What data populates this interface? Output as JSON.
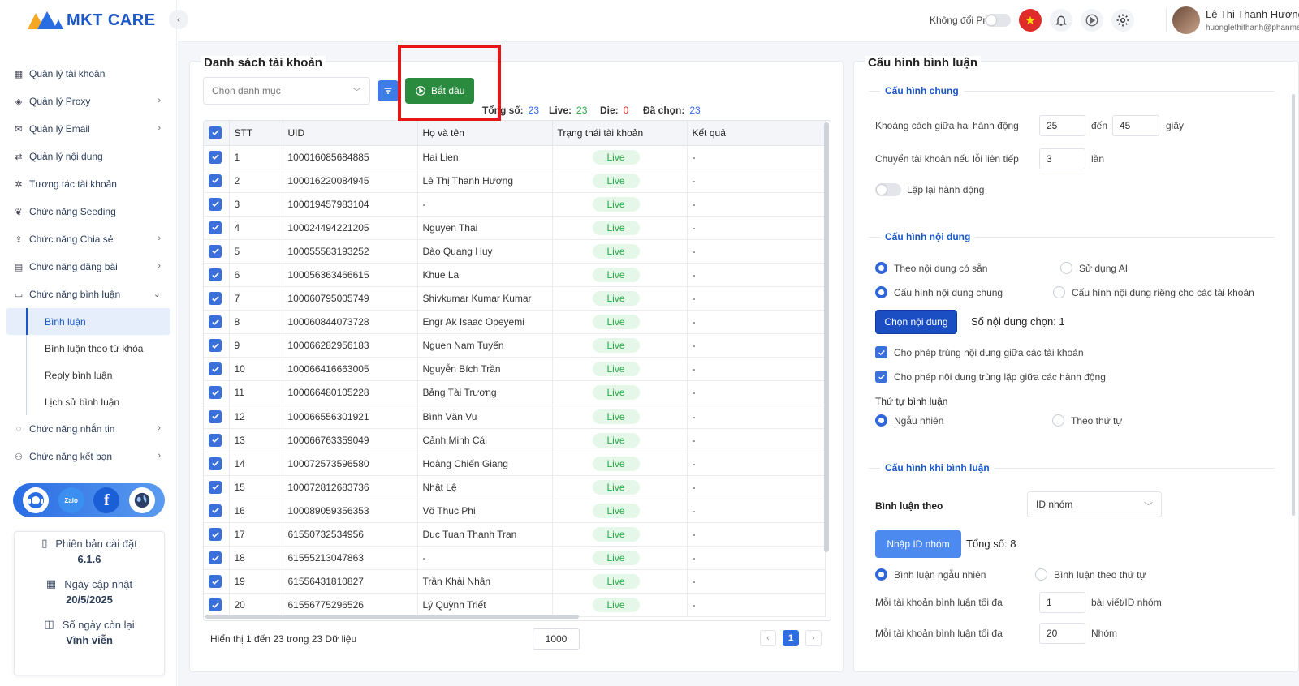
{
  "app": {
    "logo_text": "MKT CARE"
  },
  "sidebar": {
    "collapse_glyph": "‹",
    "items": [
      {
        "label": "Quản lý tài khoản",
        "icon": "grid-icon",
        "has_chevron": false
      },
      {
        "label": "Quản lý Proxy",
        "icon": "layers-icon",
        "has_chevron": true
      },
      {
        "label": "Quản lý Email",
        "icon": "mail-icon",
        "has_chevron": true
      },
      {
        "label": "Quản lý nội dung",
        "icon": "transfer-icon",
        "has_chevron": false
      },
      {
        "label": "Tương tác tài khoản",
        "icon": "sparkle-icon",
        "has_chevron": false
      },
      {
        "label": "Chức năng Seeding",
        "icon": "sprout-icon",
        "has_chevron": false
      },
      {
        "label": "Chức năng Chia sẻ",
        "icon": "share-icon",
        "has_chevron": true
      },
      {
        "label": "Chức năng đăng bài",
        "icon": "post-icon",
        "has_chevron": true
      },
      {
        "label": "Chức năng bình luận",
        "icon": "comment-icon",
        "has_chevron": true
      }
    ],
    "sub_items": [
      "Bình luận",
      "Bình luận theo từ khóa",
      "Reply bình luận",
      "Lịch sử bình luận"
    ],
    "items_after": [
      {
        "label": "Chức năng nhắn tin",
        "icon": "chat-icon"
      },
      {
        "label": "Chức năng kết bạn",
        "icon": "add-friend-icon"
      }
    ],
    "social": [
      "support-icon",
      "zalo-icon",
      "facebook-icon",
      "globe-icon"
    ],
    "zalo_text": "Zalo",
    "facebook_text": "f",
    "info": {
      "version_label": "Phiên bản cài đặt",
      "version_value": "6.1.6",
      "update_label": "Ngày cập nhật",
      "update_value": "20/5/2025",
      "days_label": "Số ngày còn lại",
      "days_value": "Vĩnh viễn"
    }
  },
  "header": {
    "proxy_label": "Không đổi Proxy",
    "user_name": "Lê Thị Thanh Hương",
    "user_email": "huonglethithanh@phanmemmkt.vn"
  },
  "accounts": {
    "title": "Danh sách tài khoản",
    "category_placeholder": "Chọn danh mục",
    "start_label": "Bắt đầu",
    "stats": {
      "total_label": "Tổng số:",
      "total": "23",
      "live_label": "Live:",
      "live": "23",
      "die_label": "Die:",
      "die": "0",
      "selected_label": "Đã chọn:",
      "selected": "23"
    },
    "columns": [
      "STT",
      "UID",
      "Họ và tên",
      "Trạng thái tài khoản",
      "Kết quả"
    ],
    "rows": [
      [
        "1",
        "100016085684885",
        "Hai Lien",
        "Live",
        "-"
      ],
      [
        "2",
        "100016220084945",
        "Lê Thị Thanh Hương",
        "Live",
        "-"
      ],
      [
        "3",
        "100019457983104",
        "-",
        "Live",
        "-"
      ],
      [
        "4",
        "100024494221205",
        "Nguyen Thai",
        "Live",
        "-"
      ],
      [
        "5",
        "100055583193252",
        "Đào Quang Huy",
        "Live",
        "-"
      ],
      [
        "6",
        "100056363466615",
        "Khue La",
        "Live",
        "-"
      ],
      [
        "7",
        "100060795005749",
        "Shivkumar Kumar Kumar",
        "Live",
        "-"
      ],
      [
        "8",
        "100060844073728",
        "Engr Ak Isaac Opeyemi",
        "Live",
        "-"
      ],
      [
        "9",
        "100066282956183",
        "Nguen Nam Tuyến",
        "Live",
        "-"
      ],
      [
        "10",
        "100066416663005",
        "Nguyễn Bích Trần",
        "Live",
        "-"
      ],
      [
        "11",
        "100066480105228",
        "Bảng Tài Trương",
        "Live",
        "-"
      ],
      [
        "12",
        "100066556301921",
        "Bình Văn Vu",
        "Live",
        "-"
      ],
      [
        "13",
        "100066763359049",
        "Cảnh Minh Cái",
        "Live",
        "-"
      ],
      [
        "14",
        "100072573596580",
        "Hoàng Chiến Giang",
        "Live",
        "-"
      ],
      [
        "15",
        "100072812683736",
        "Nhật Lệ",
        "Live",
        "-"
      ],
      [
        "16",
        "100089059356353",
        "Võ Thục Phi",
        "Live",
        "-"
      ],
      [
        "17",
        "61550732534956",
        "Duc Tuan Thanh Tran",
        "Live",
        "-"
      ],
      [
        "18",
        "61555213047863",
        "-",
        "Live",
        "-"
      ],
      [
        "19",
        "61556431810827",
        "Trần Khải Nhân",
        "Live",
        "-"
      ],
      [
        "20",
        "61556775296526",
        "Lý Quỳnh Triết",
        "Live",
        "-"
      ]
    ],
    "footer_text": "Hiển thị 1 đến 23 trong 23 Dữ liệu",
    "page_size": "1000",
    "current_page": "1",
    "prev_glyph": "‹",
    "next_glyph": "›"
  },
  "config": {
    "title": "Cấu hình bình luận",
    "general": {
      "title": "Cấu hình chung",
      "gap_label": "Khoảng cách giữa hai hành động",
      "gap_from": "25",
      "to_label": "đến",
      "gap_to": "45",
      "seconds_label": "giây",
      "switch_label": "Chuyển tài khoản nếu lỗi liên tiếp",
      "switch_value": "3",
      "times_label": "lần",
      "repeat_label": "Lặp lại hành động"
    },
    "content": {
      "title": "Cấu hình nội dung",
      "opt_available": "Theo nội dung có sẵn",
      "opt_ai": "Sử dụng AI",
      "opt_common": "Cấu hình nội dung chung",
      "opt_private": "Cấu hình nội dung riêng cho các tài khoản",
      "choose_btn": "Chọn nội dung",
      "chosen_count": "Số nội dung chọn: 1",
      "allow_dup_accounts": "Cho phép trùng nội dung giữa các tài khoản",
      "allow_dup_actions": "Cho phép nội dung trùng lặp giữa các hành động",
      "order_label": "Thứ tự bình luận",
      "order_random": "Ngẫu nhiên",
      "order_seq": "Theo thứ tự"
    },
    "when": {
      "title": "Cấu hình khi bình luận",
      "comment_by_label": "Bình luận theo",
      "comment_by_value": "ID nhóm",
      "enter_id_btn": "Nhập ID nhóm",
      "total": "Tổng số: 8",
      "random_label": "Bình luận ngẫu nhiên",
      "seq_label": "Bình luận theo thứ tự",
      "max_label_1": "Mỗi tài khoản bình luận tối đa",
      "max_value_1": "1",
      "max_unit_1": "bài viết/ID nhóm",
      "max_label_2": "Mỗi tài khoản bình luận tối đa",
      "max_value_2": "20",
      "max_unit_2": "Nhóm"
    }
  },
  "colors": {
    "primary": "#1a57c9",
    "live_green": "#29a845",
    "start_green": "#2a8a3e",
    "highlight_red": "#e81515"
  }
}
